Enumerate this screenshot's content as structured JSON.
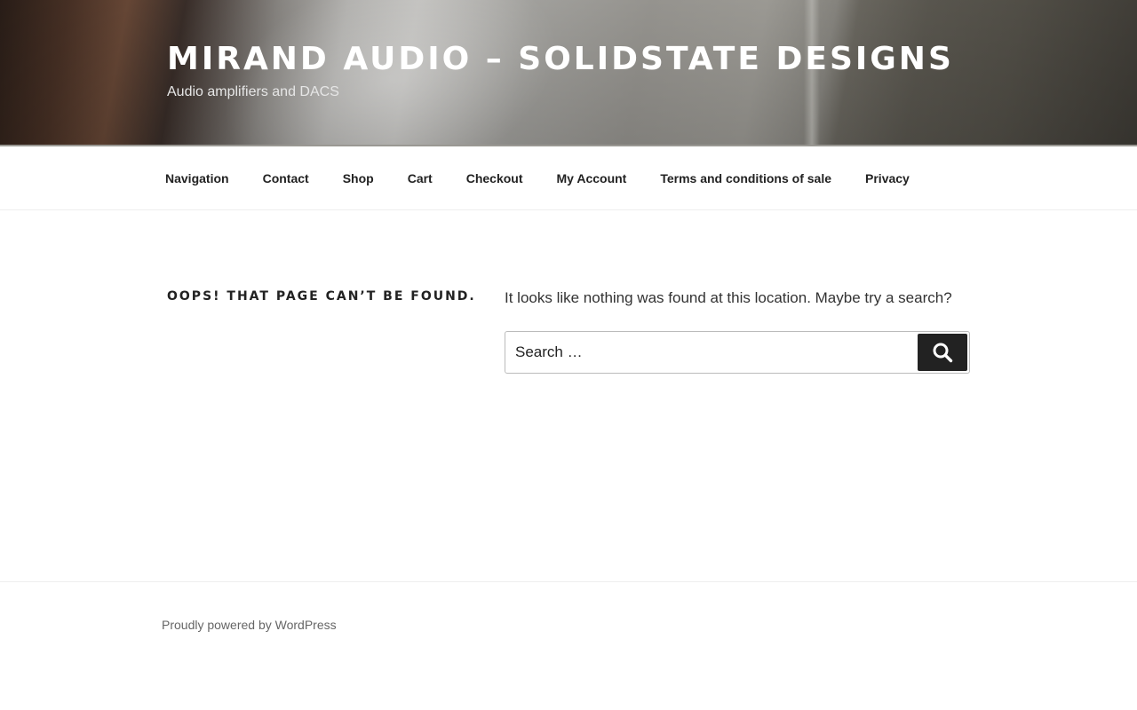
{
  "header": {
    "site_title": "MIRAND AUDIO – SOLIDSTATE DESIGNS",
    "site_description": "Audio amplifiers and DACS"
  },
  "nav": {
    "items": [
      {
        "label": "Navigation"
      },
      {
        "label": "Contact"
      },
      {
        "label": "Shop"
      },
      {
        "label": "Cart"
      },
      {
        "label": "Checkout"
      },
      {
        "label": "My Account"
      },
      {
        "label": "Terms and conditions of sale"
      },
      {
        "label": "Privacy"
      }
    ]
  },
  "main": {
    "page_title": "OOPS! THAT PAGE CAN’T BE FOUND.",
    "message": "It looks like nothing was found at this location. Maybe try a search?",
    "search": {
      "placeholder": "Search …",
      "value": "",
      "button_icon": "search-icon"
    }
  },
  "footer": {
    "credit": "Proudly powered by WordPress"
  },
  "colors": {
    "text": "#222222",
    "button_bg": "#222222",
    "footer_text": "#666666",
    "header_title": "#ffffff"
  }
}
